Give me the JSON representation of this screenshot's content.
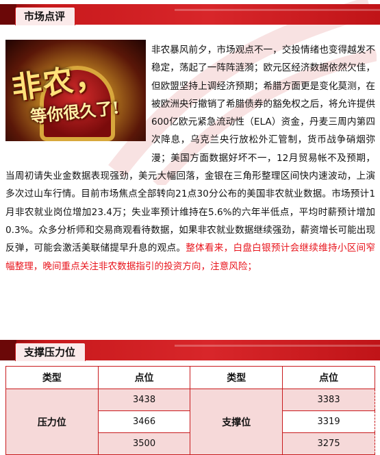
{
  "sections": {
    "commentary_title": "市场点评",
    "levels_title": "支撑压力位"
  },
  "image": {
    "headline": "非农，",
    "subline": "等你很久了!"
  },
  "article": {
    "paragraph_black": "非农暴风前夕，市场观点不一，交投情绪也变得越发不稳定，荡起了一阵阵涟漪；欧元区经济数据依然欠佳，但欧盟坚持上调经济预期；希腊方面更是变化莫测，在被欧洲央行撤销了希腊债券的豁免权之后，将允许提供600亿欧元紧急流动性（ELA）资金，丹麦三周内第四次降息，乌克兰央行放松外汇管制，货币战争硝烟弥漫；美国方面数据好坏不一，12月贸易帐不及预期，当周初请失业金数据表现强劲，美元大幅回落，金银在三角形整理区间快内速波动，上演多次过山车行情。目前市场焦点全部转向21点30分公布的美国非农就业数据。市场预计1月非农就业岗位增加23.4万；失业率预计维持在5.6%的六年半低点，平均时薪预计增加0.3%。众多分析师和交易商观看待数据，如果非农就业数据继续强劲，薪资增长可能出现反弹，可能会激活美联储提早升息的观点。",
    "paragraph_red": "整体看来，白盘白银预计会继续维持小区间窄幅整理，晚间重点关注非农数据指引的投资方向，注意风险；"
  },
  "table": {
    "headers": [
      "类型",
      "点位",
      "类型",
      "点位"
    ],
    "pressure_label": "压力位",
    "support_label": "支撑位",
    "pressure_levels": [
      "3438",
      "3466",
      "3500"
    ],
    "support_levels": [
      "3383",
      "3319",
      "3275"
    ]
  },
  "colors": {
    "accent_red": "#c8191c",
    "highlight_red": "#e8141c",
    "table_pink": "#f6d9d9"
  }
}
